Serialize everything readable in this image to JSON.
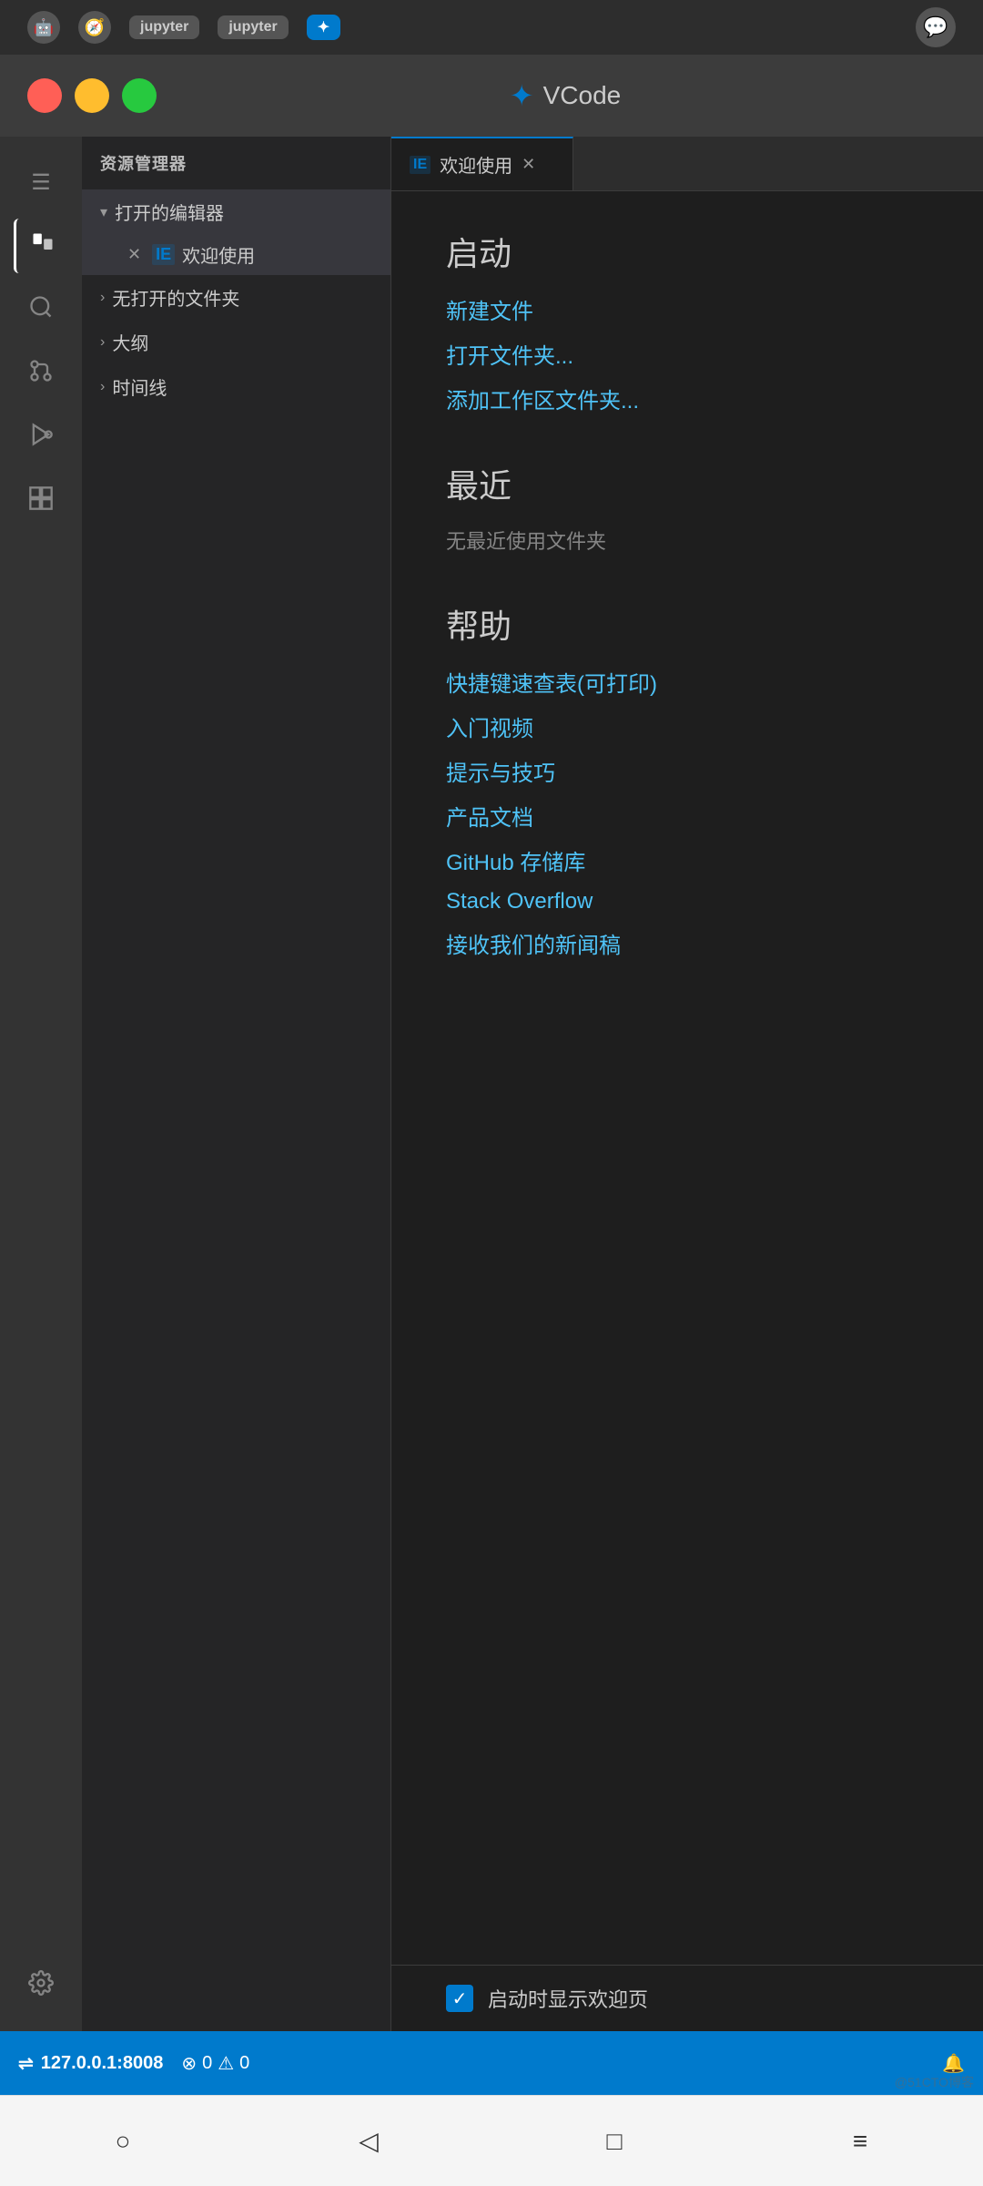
{
  "topbar": {
    "icons": [
      "android",
      "compass",
      "jupyter1",
      "jupyter2",
      "vscode",
      "chat"
    ],
    "active_tab": "vscode"
  },
  "titlebar": {
    "title": "VCode",
    "app_name": "VCode"
  },
  "activitybar": {
    "items": [
      {
        "id": "explorer",
        "icon": "📄",
        "label": "Explorer",
        "active": true
      },
      {
        "id": "search",
        "icon": "🔍",
        "label": "Search"
      },
      {
        "id": "git",
        "icon": "⑂",
        "label": "Source Control"
      },
      {
        "id": "debug",
        "icon": "▷",
        "label": "Run and Debug"
      },
      {
        "id": "extensions",
        "icon": "⊞",
        "label": "Extensions"
      }
    ],
    "bottom": [
      {
        "id": "settings",
        "icon": "⚙",
        "label": "Settings"
      }
    ]
  },
  "sidebar": {
    "title": "资源管理器",
    "sections": [
      {
        "id": "open-editors",
        "label": "打开的编辑器",
        "expanded": true,
        "files": [
          {
            "name": "欢迎使用",
            "icon": "IE",
            "active": true
          }
        ]
      },
      {
        "id": "no-folder",
        "label": "无打开的文件夹",
        "expanded": false
      },
      {
        "id": "outline",
        "label": "大纲",
        "expanded": false
      },
      {
        "id": "timeline",
        "label": "时间线",
        "expanded": false
      }
    ]
  },
  "editor": {
    "tabs": [
      {
        "id": "welcome",
        "label": "欢迎使用",
        "icon": "IE",
        "active": true
      }
    ],
    "welcome": {
      "sections": [
        {
          "id": "start",
          "title": "启动",
          "links": [
            {
              "id": "new-file",
              "label": "新建文件"
            },
            {
              "id": "open-folder",
              "label": "打开文件夹..."
            },
            {
              "id": "add-workspace",
              "label": "添加工作区文件夹..."
            }
          ]
        },
        {
          "id": "recent",
          "title": "最近",
          "empty_message": "无最近使用文件夹"
        },
        {
          "id": "help",
          "title": "帮助",
          "links": [
            {
              "id": "shortcuts",
              "label": "快捷键速查表(可打印)"
            },
            {
              "id": "intro-videos",
              "label": "入门视频"
            },
            {
              "id": "tips-tricks",
              "label": "提示与技巧"
            },
            {
              "id": "product-docs",
              "label": "产品文档"
            },
            {
              "id": "github-repo",
              "label": "GitHub 存储库"
            },
            {
              "id": "stack-overflow",
              "label": "Stack Overflow"
            },
            {
              "id": "newsletter",
              "label": "接收我们的新闻稿"
            }
          ]
        }
      ],
      "footer": {
        "checkbox_checked": true,
        "label": "启动时显示欢迎页"
      }
    }
  },
  "statusbar": {
    "remote": "127.0.0.1:8008",
    "errors": "0",
    "warnings": "0",
    "error_icon": "⊗",
    "warning_icon": "⚠",
    "bell_icon": "🔔"
  },
  "bottomnav": {
    "buttons": [
      {
        "id": "home",
        "icon": "○"
      },
      {
        "id": "back",
        "icon": "◁"
      },
      {
        "id": "recent",
        "icon": "□"
      },
      {
        "id": "menu",
        "icon": "≡"
      }
    ]
  },
  "watermark": {
    "text": "@51CTO博客"
  }
}
